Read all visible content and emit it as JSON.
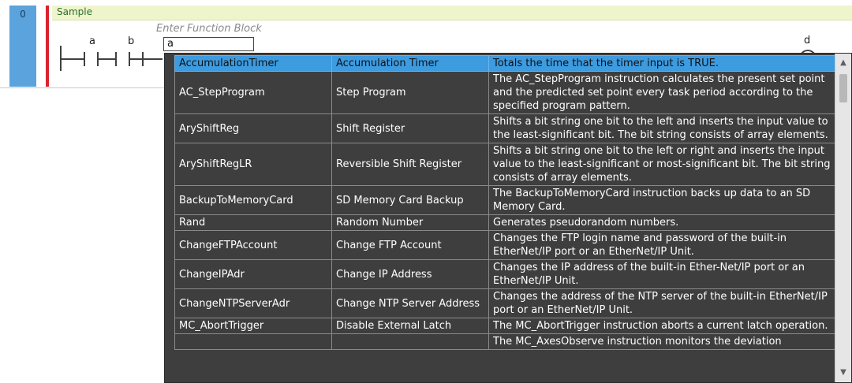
{
  "rung": {
    "number": "0",
    "title": "Sample",
    "contacts": [
      "a",
      "b"
    ],
    "coil": "d"
  },
  "function_block_input": {
    "hint": "Enter Function Block",
    "value": "a"
  },
  "popup": {
    "rows": [
      {
        "name": "AccumulationTimer",
        "title": "Accumulation Timer",
        "description": "Totals the time that the timer input is TRUE.",
        "selected": true
      },
      {
        "name": "AC_StepProgram",
        "title": "Step Program",
        "description": "The AC_StepProgram instruction calculates the present set point and the predicted set point every task period according to the specified program pattern."
      },
      {
        "name": "AryShiftReg",
        "title": "Shift Register",
        "description": "Shifts a bit string one bit to the left and inserts the input value to the least-significant bit. The bit string consists of array elements."
      },
      {
        "name": "AryShiftRegLR",
        "title": "Reversible Shift Register",
        "description": "Shifts a bit string one bit to the left or right and inserts the input value to the least-significant or most-significant bit. The bit string consists of array elements."
      },
      {
        "name": "BackupToMemoryCard",
        "title": "SD Memory Card Backup",
        "description": "The BackupToMemoryCard instruction backs up data to an SD Memory Card."
      },
      {
        "name": "Rand",
        "title": "Random Number",
        "description": "Generates pseudorandom numbers."
      },
      {
        "name": "ChangeFTPAccount",
        "title": "Change FTP Account",
        "description": "Changes the FTP login name and password of the built-in EtherNet/IP port or an EtherNet/IP Unit."
      },
      {
        "name": "ChangeIPAdr",
        "title": "Change IP Address",
        "description": "Changes the IP address of the built-in Ether-Net/IP port or an EtherNet/IP Unit."
      },
      {
        "name": "ChangeNTPServerAdr",
        "title": "Change NTP Server Address",
        "description": "Changes the address of the NTP server of the built-in EtherNet/IP port or an EtherNet/IP Unit."
      },
      {
        "name": "MC_AbortTrigger",
        "title": "Disable External Latch",
        "description": "The MC_AbortTrigger instruction aborts a current latch operation."
      },
      {
        "name": "",
        "title": "",
        "description": "The MC_AxesObserve instruction monitors the deviation"
      }
    ]
  }
}
